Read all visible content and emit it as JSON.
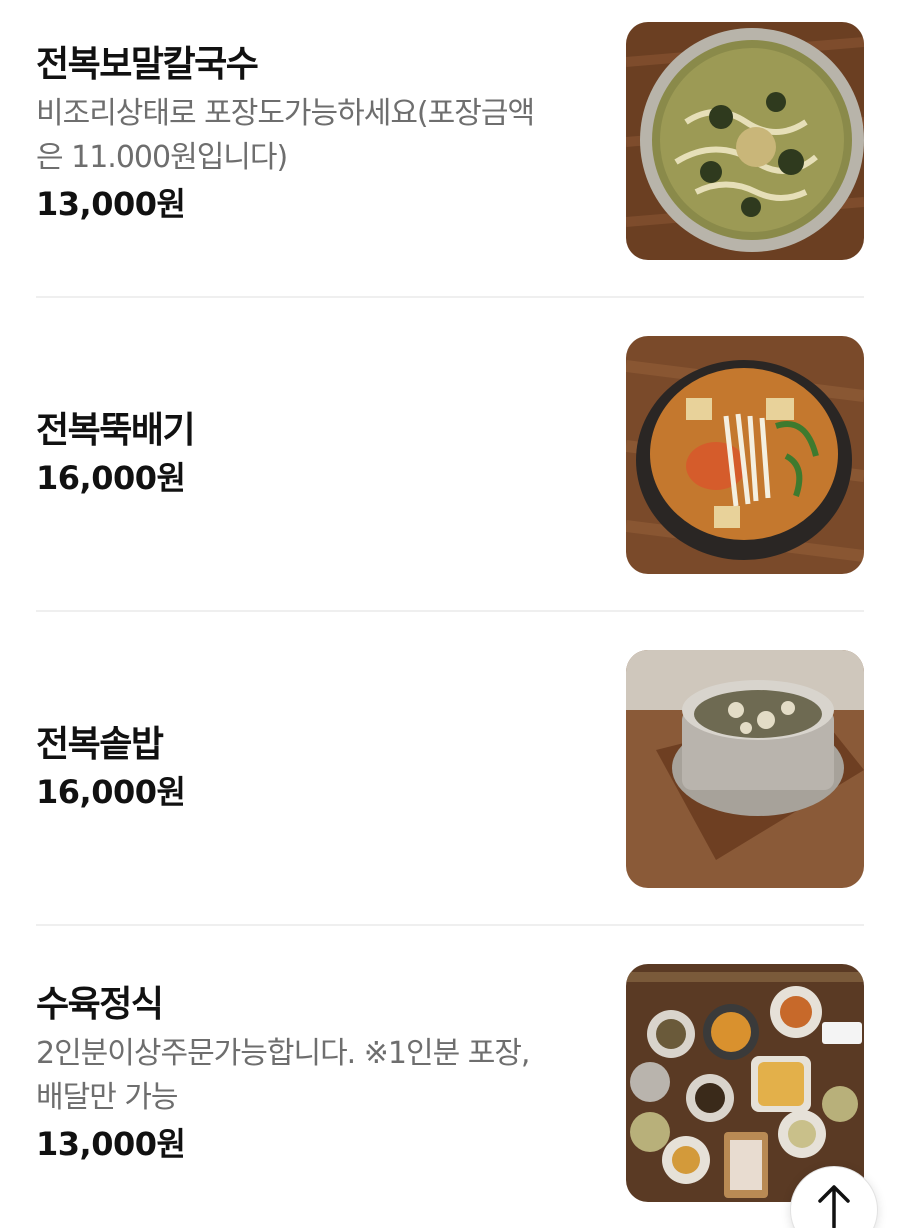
{
  "menu": {
    "items": [
      {
        "name": "전복보말칼국수",
        "description": "비조리상태로 포장도가능하세요(포장금액\n은 11.000원입니다)",
        "price": "13,000원",
        "image": "kalguksu-photo"
      },
      {
        "name": "전복뚝배기",
        "description": "",
        "price": "16,000원",
        "image": "ttukbaegi-photo"
      },
      {
        "name": "전복솥밥",
        "description": "",
        "price": "16,000원",
        "image": "sotbap-photo"
      },
      {
        "name": "수육정식",
        "description": "2인분이상주문가능합니다. ※1인분 포장,\n배달만 가능",
        "price": "13,000원",
        "image": "suyuk-set-photo"
      }
    ]
  },
  "scroll_top": {
    "icon": "arrow-up-icon"
  },
  "colors": {
    "text_primary": "#111111",
    "text_secondary": "#6e6e6e",
    "divider": "#efefef",
    "wood": "#7a4a2a"
  }
}
